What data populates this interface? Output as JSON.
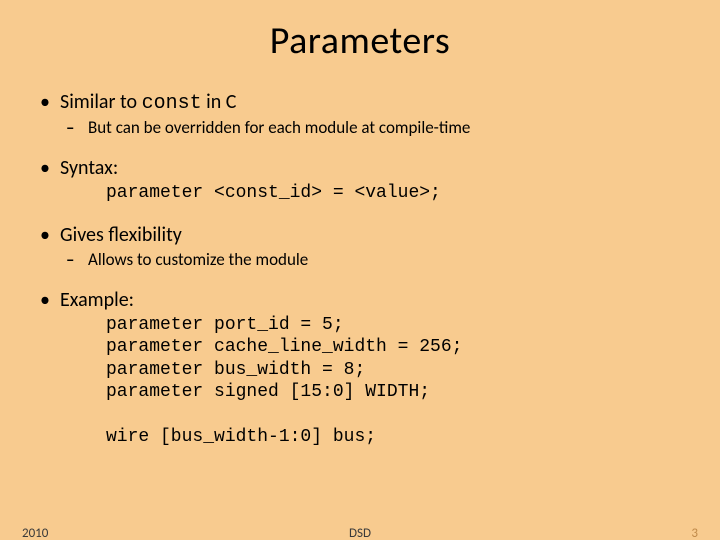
{
  "title": "Parameters",
  "bullets": {
    "b1": {
      "pre": "Similar to ",
      "code": "const",
      "post": " in C"
    },
    "b1sub": "But can be overridden for each module at compile-time",
    "b2": "Syntax:",
    "b2code": "parameter <const_id> = <value>;",
    "b3": "Gives flexibility",
    "b3sub": "Allows to customize the module",
    "b4": "Example:",
    "b4code": "parameter port_id = 5;\nparameter cache_line_width = 256;\nparameter bus_width = 8;\nparameter signed [15:0] WIDTH;\n\nwire [bus_width-1:0] bus;"
  },
  "footer": {
    "year": "2010",
    "mid": "DSD",
    "num": "3"
  }
}
